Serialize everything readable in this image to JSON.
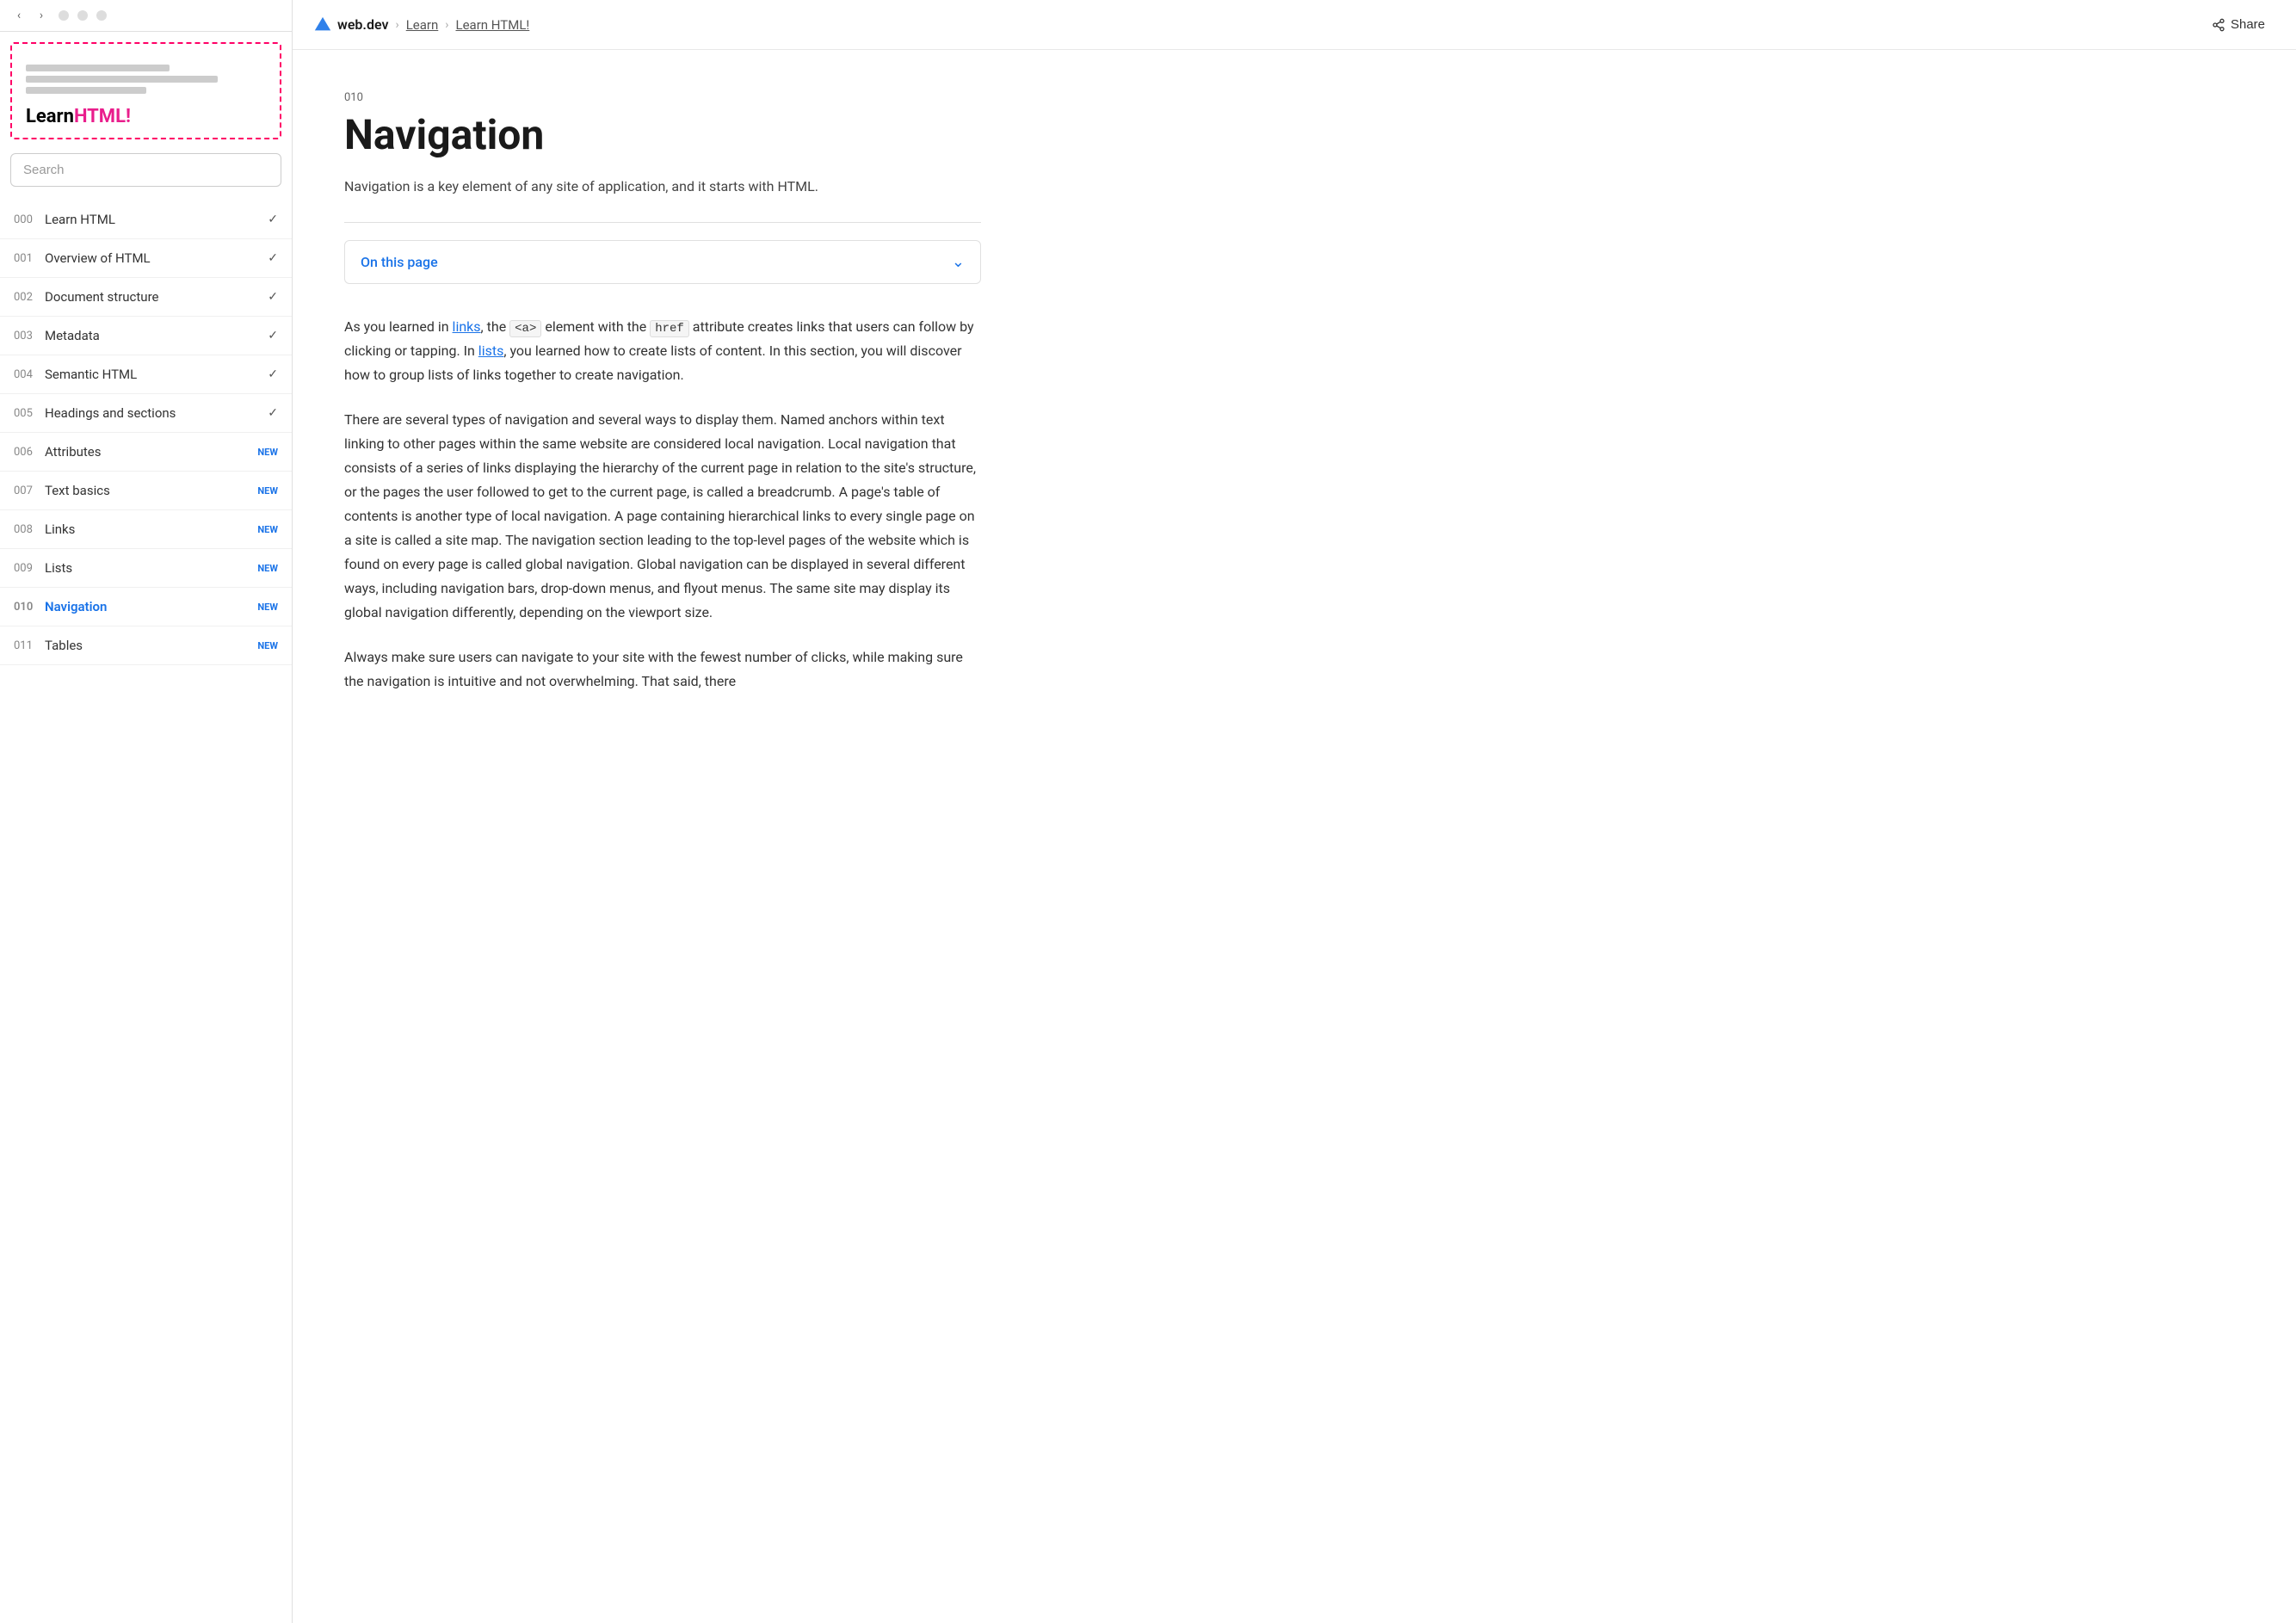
{
  "sidebar": {
    "title_learn": "Learn",
    "title_html": "HTML!",
    "search_placeholder": "Search",
    "nav_items": [
      {
        "num": "000",
        "label": "Learn HTML",
        "badge": "",
        "checked": true
      },
      {
        "num": "001",
        "label": "Overview of HTML",
        "badge": "",
        "checked": true
      },
      {
        "num": "002",
        "label": "Document structure",
        "badge": "",
        "checked": true
      },
      {
        "num": "003",
        "label": "Metadata",
        "badge": "",
        "checked": true
      },
      {
        "num": "004",
        "label": "Semantic HTML",
        "badge": "",
        "checked": true
      },
      {
        "num": "005",
        "label": "Headings and sections",
        "badge": "",
        "checked": true
      },
      {
        "num": "006",
        "label": "Attributes",
        "badge": "NEW",
        "checked": false
      },
      {
        "num": "007",
        "label": "Text basics",
        "badge": "NEW",
        "checked": false
      },
      {
        "num": "008",
        "label": "Links",
        "badge": "NEW",
        "checked": false
      },
      {
        "num": "009",
        "label": "Lists",
        "badge": "NEW",
        "checked": false
      },
      {
        "num": "010",
        "label": "Navigation",
        "badge": "NEW",
        "checked": false,
        "active": true
      },
      {
        "num": "011",
        "label": "Tables",
        "badge": "NEW",
        "checked": false
      }
    ]
  },
  "topbar": {
    "brand": "web.dev",
    "learn_link": "Learn",
    "current_link": "Learn HTML!",
    "share_label": "Share"
  },
  "article": {
    "number": "010",
    "title": "Navigation",
    "subtitle": "Navigation is a key element of any site of application, and it starts with HTML.",
    "on_this_page": "On this page",
    "body_p1_start": "As you learned in ",
    "links_link": "links",
    "body_p1_mid1": ", the ",
    "a_tag": "<a>",
    "body_p1_mid2": " element with the ",
    "href_attr": "href",
    "body_p1_end": " attribute creates links that users can follow by clicking or tapping. In ",
    "lists_link": "lists",
    "body_p1_end2": ", you learned how to create lists of content. In this section, you will discover how to group lists of links together to create navigation.",
    "body_p2": "There are several types of navigation and several ways to display them. Named anchors within text linking to other pages within the same website are considered local navigation. Local navigation that consists of a series of links displaying the hierarchy of the current page in relation to the site's structure, or the pages the user followed to get to the current page, is called a breadcrumb. A page's table of contents is another type of local navigation. A page containing hierarchical links to every single page on a site is called a site map. The navigation section leading to the top-level pages of the website which is found on every page is called global navigation. Global navigation can be displayed in several different ways, including navigation bars, drop-down menus, and flyout menus. The same site may display its global navigation differently, depending on the viewport size.",
    "body_p3_start": "Always make sure users can navigate to your site with the fewest number of clicks, while making sure the navigation is intuitive and not overwhelming. That said, there"
  }
}
